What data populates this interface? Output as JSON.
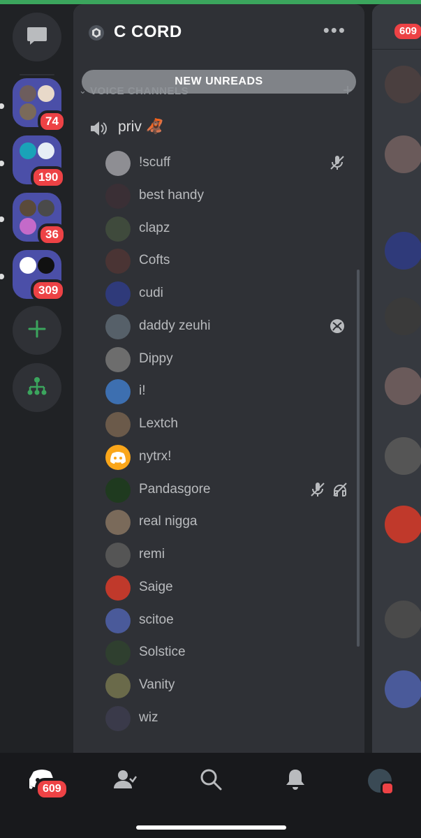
{
  "server": {
    "name": "C CORD"
  },
  "banner": {
    "label": "NEW UNREADS"
  },
  "category": {
    "label": "VOICE CHANNELS"
  },
  "channel": {
    "name": "priv 🦧"
  },
  "rail": {
    "folders": [
      {
        "badge": "74"
      },
      {
        "badge": "190"
      },
      {
        "badge": "36"
      },
      {
        "badge": "309"
      }
    ]
  },
  "peek": {
    "badge": "609"
  },
  "nav": {
    "home_badge": "609"
  },
  "members": [
    {
      "name": "!scuff",
      "color": "#8e8e93",
      "status": "muted"
    },
    {
      "name": "best handy",
      "color": "#3a2f35",
      "status": ""
    },
    {
      "name": "clapz",
      "color": "#3f4a3c",
      "status": ""
    },
    {
      "name": "Cofts",
      "color": "#4a3434",
      "status": ""
    },
    {
      "name": "cudi",
      "color": "#2f3a7a",
      "status": ""
    },
    {
      "name": "daddy zeuhi",
      "color": "#566069",
      "status": "xbox"
    },
    {
      "name": "Dippy",
      "color": "#6d6d6d",
      "status": ""
    },
    {
      "name": "i!",
      "color": "#3d6fb0",
      "status": ""
    },
    {
      "name": "Lextch",
      "color": "#6b5a4a",
      "status": ""
    },
    {
      "name": "nytrx!",
      "color": "#faa61a",
      "status": ""
    },
    {
      "name": "Pandasgore",
      "color": "#1f3a1f",
      "status": "muted-deafened"
    },
    {
      "name": "real nigga",
      "color": "#7a6a5a",
      "status": ""
    },
    {
      "name": "remi",
      "color": "#555555",
      "status": ""
    },
    {
      "name": "Saige",
      "color": "#c0392b",
      "status": ""
    },
    {
      "name": "scitoe",
      "color": "#4a5a9a",
      "status": ""
    },
    {
      "name": "Solstice",
      "color": "#2f3f2f",
      "status": ""
    },
    {
      "name": "Vanity",
      "color": "#6a6a4a",
      "status": ""
    },
    {
      "name": "wiz",
      "color": "#3a3a4a",
      "status": ""
    }
  ]
}
